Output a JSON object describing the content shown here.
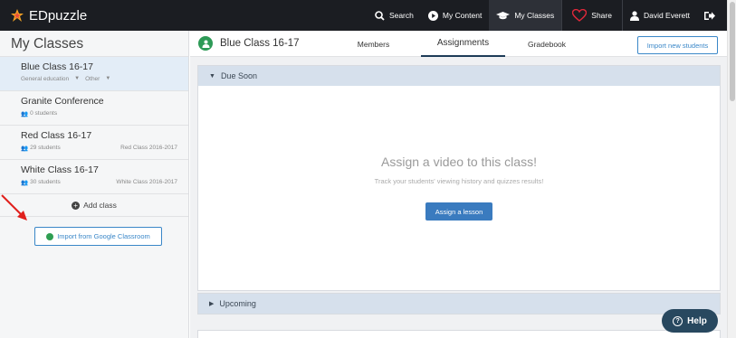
{
  "navbar": {
    "brand": "EDpuzzle",
    "items": [
      {
        "label": "Search",
        "icon": "search-icon"
      },
      {
        "label": "My Content",
        "icon": "play-circle-icon"
      },
      {
        "label": "My Classes",
        "icon": "graduation-cap-icon"
      },
      {
        "label": "Share",
        "icon": "heart-icon"
      },
      {
        "label": "David Everett",
        "icon": "user-icon"
      },
      {
        "label": "",
        "icon": "sign-out-icon"
      }
    ]
  },
  "sidebar": {
    "title": "My Classes",
    "classes": [
      {
        "name": "Blue Class 16-17",
        "meta_left": "General education",
        "meta_tag": "Other",
        "meta_right": ""
      },
      {
        "name": "Granite Conference",
        "meta_left": "0 students",
        "meta_right": ""
      },
      {
        "name": "Red Class 16-17",
        "meta_left": "29 students",
        "meta_right": "Red Class 2016-2017"
      },
      {
        "name": "White Class 16-17",
        "meta_left": "30 students",
        "meta_right": "White Class 2016-2017"
      }
    ],
    "add_class": "Add class",
    "import_google": "Import from Google Classroom"
  },
  "main": {
    "class_title": "Blue Class 16-17",
    "tabs": [
      "Members",
      "Assignments",
      "Gradebook"
    ],
    "import_students": "Import new students",
    "due_soon": {
      "header": "Due Soon",
      "empty_title": "Assign a video to this class!",
      "empty_subtitle": "Track your students' viewing history and quizzes results!",
      "assign_button": "Assign a lesson"
    },
    "upcoming": {
      "header": "Upcoming"
    }
  },
  "help": {
    "label": "Help"
  },
  "colors": {
    "navbar": "#1b1d22",
    "accent_blue": "#3a87c8",
    "panel_header": "#d6e0ec",
    "green": "#2e9a57",
    "help_bg": "#28485f",
    "annotation_red": "#e0201c"
  }
}
